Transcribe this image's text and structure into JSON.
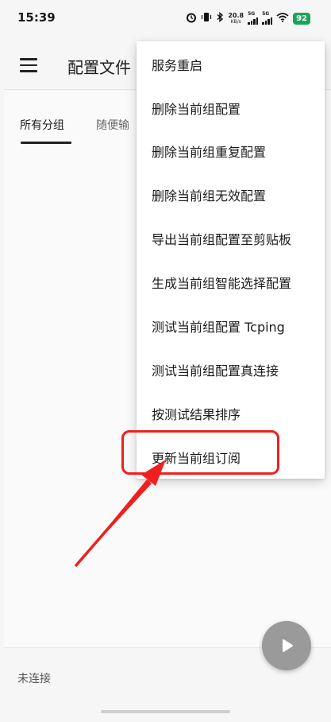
{
  "status_bar": {
    "time": "15:39",
    "net_speed_value": "20.8",
    "net_speed_unit": "KB/s",
    "signal1_label": "5G",
    "signal2_label": "5G",
    "battery": "92",
    "icons": [
      "alarm-icon",
      "vibrate-icon",
      "bluetooth-icon",
      "signal-icon",
      "wifi-icon",
      "battery-icon"
    ]
  },
  "app_bar": {
    "title": "配置文件"
  },
  "tabs": [
    {
      "label": "所有分组",
      "active": true
    },
    {
      "label": "随便输",
      "active": false
    }
  ],
  "popup_menu": {
    "items": [
      {
        "label": "服务重启"
      },
      {
        "label": "删除当前组配置"
      },
      {
        "label": "删除当前组重复配置"
      },
      {
        "label": "删除当前组无效配置"
      },
      {
        "label": "导出当前组配置至剪贴板"
      },
      {
        "label": "生成当前组智能选择配置"
      },
      {
        "label": "测试当前组配置 Tcping"
      },
      {
        "label": "测试当前组配置真连接"
      },
      {
        "label": "按测试结果排序"
      },
      {
        "label": "更新当前组订阅",
        "highlighted": true
      }
    ]
  },
  "bottom": {
    "connection_status": "未连接"
  },
  "colors": {
    "annotation": "#f01f1f",
    "fab": "#9a9a9a",
    "battery": "#1aa45a"
  }
}
